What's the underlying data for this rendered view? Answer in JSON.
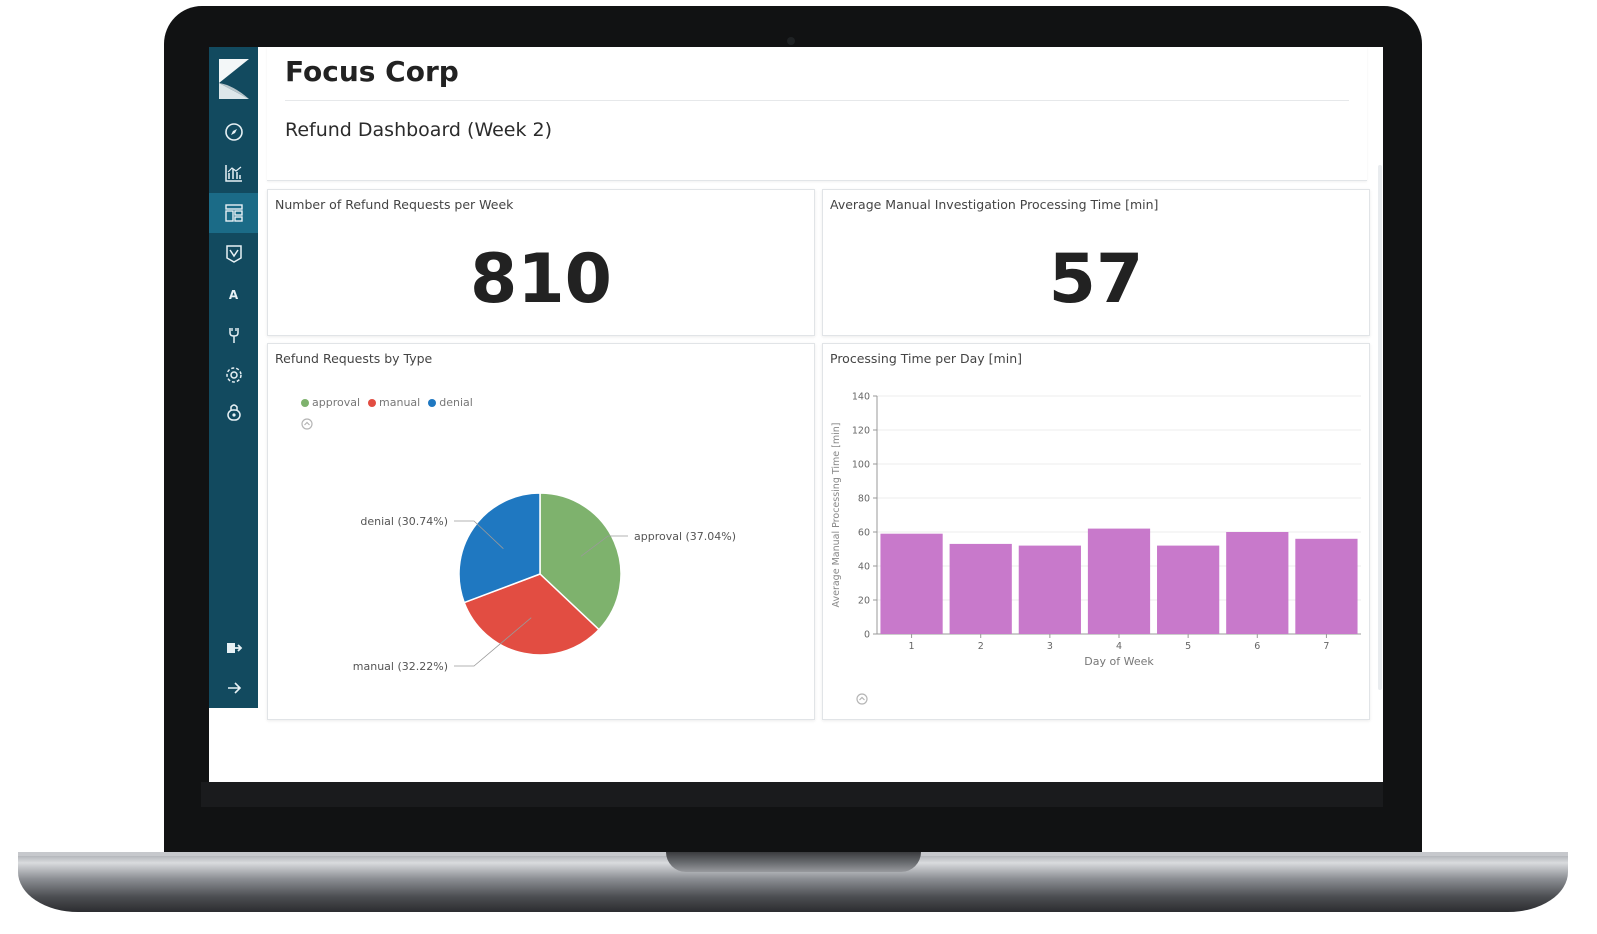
{
  "header": {
    "org": "Focus Corp",
    "dashboard_title": "Refund Dashboard (Week 2)"
  },
  "sidebar": {
    "items": [
      {
        "icon": "compass-icon"
      },
      {
        "icon": "visualize-icon"
      },
      {
        "icon": "dashboard-icon",
        "active": true
      },
      {
        "icon": "timelion-icon"
      },
      {
        "icon": "apm-icon",
        "label": "A"
      },
      {
        "icon": "dev-tools-icon"
      },
      {
        "icon": "gear-icon"
      },
      {
        "icon": "lock-icon"
      },
      {
        "icon": "logout-icon"
      },
      {
        "icon": "expand-arrow-icon"
      }
    ]
  },
  "panels": {
    "refund_count": {
      "title": "Number of Refund Requests per Week",
      "value": "810"
    },
    "avg_time": {
      "title": "Average Manual Investigation Processing Time [min]",
      "value": "57"
    },
    "by_type": {
      "title": "Refund Requests by Type",
      "legend": [
        {
          "label": "approval",
          "color": "#7eb26d"
        },
        {
          "label": "manual",
          "color": "#e24d42"
        },
        {
          "label": "denial",
          "color": "#1f78c1"
        }
      ]
    },
    "per_day": {
      "title": "Processing Time per Day [min]"
    }
  },
  "chart_data": [
    {
      "type": "pie",
      "title": "Refund Requests by Type",
      "labels": [
        "approval",
        "manual",
        "denial"
      ],
      "values": [
        37.04,
        32.22,
        30.74
      ],
      "colors": [
        "#7eb26d",
        "#e24d42",
        "#1f78c1"
      ],
      "slice_labels": [
        "approval (37.04%)",
        "manual (32.22%)",
        "denial (30.74%)"
      ],
      "legend": "top-left"
    },
    {
      "type": "bar",
      "title": "Processing Time per Day [min]",
      "categories": [
        "1",
        "2",
        "3",
        "4",
        "5",
        "6",
        "7"
      ],
      "values": [
        59,
        53,
        52,
        62,
        52,
        60,
        56
      ],
      "xlabel": "Day of Week",
      "ylabel": "Average Manual Processing Time [min]",
      "ylim": [
        0,
        140
      ],
      "yticks": [
        0,
        20,
        40,
        60,
        80,
        100,
        120,
        140
      ],
      "color": "#c879cb",
      "grid": true
    }
  ]
}
